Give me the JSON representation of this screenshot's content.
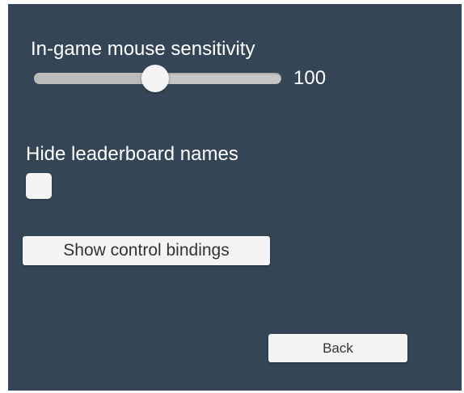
{
  "settings": {
    "mouse_sensitivity_label": "In-game mouse sensitivity",
    "mouse_sensitivity_value": "100",
    "mouse_sensitivity_fraction": 0.49,
    "hide_leaderboard_label": "Hide leaderboard names",
    "hide_leaderboard_checked": false,
    "show_bindings_label": "Show control bindings",
    "back_label": "Back"
  },
  "colors": {
    "panel_background": "#344656",
    "text": "#ffffff",
    "control_fill": "#f4f4f4",
    "slider_track": "#c6c6c6",
    "button_text": "#333333"
  }
}
